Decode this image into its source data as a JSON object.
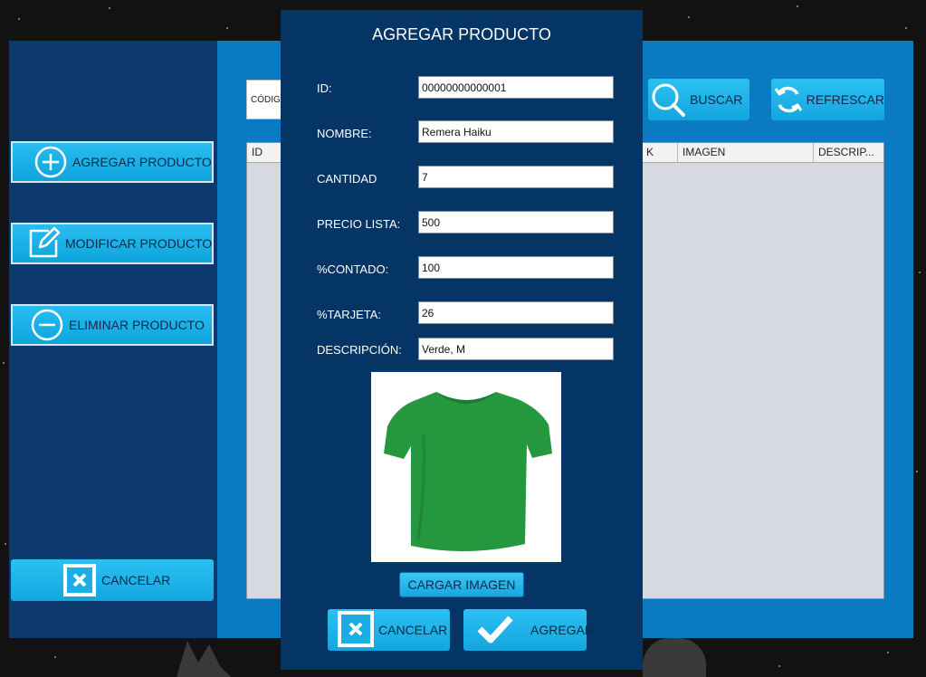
{
  "sidebar": {
    "add_label": "AGREGAR PRODUCTO",
    "modify_label": "MODIFICAR PRODUCTO",
    "delete_label": "ELIMINAR PRODUCTO",
    "cancel_label": "CANCELAR"
  },
  "toolbar": {
    "search_field_text": "CÓDIG",
    "search_label": "BUSCAR",
    "refresh_label": "REFRESCAR"
  },
  "table": {
    "columns": [
      "ID",
      "K",
      "IMAGEN",
      "DESCRIP..."
    ]
  },
  "dialog": {
    "title": "AGREGAR PRODUCTO",
    "fields": {
      "id": {
        "label": "ID:",
        "value": "00000000000001"
      },
      "name": {
        "label": "NOMBRE:",
        "value": "Remera Haiku"
      },
      "quantity": {
        "label": "CANTIDAD",
        "value": "7"
      },
      "list_price": {
        "label": "PRECIO LISTA:",
        "value": "500"
      },
      "cash_pct": {
        "label": "%CONTADO:",
        "value": "100"
      },
      "card_pct": {
        "label": "%TARJETA:",
        "value": "26"
      },
      "description": {
        "label": "DESCRIPCIÓN:",
        "value": "Verde, M"
      }
    },
    "load_image_label": "CARGAR IMAGEN",
    "cancel_label": "CANCELAR",
    "add_label": "AGREGAR"
  },
  "colors": {
    "sidebar_bg": "#0c3a6e",
    "content_bg": "#0a7bc3",
    "dialog_bg": "#053565",
    "button_accent": "#1aaee5",
    "shirt_green": "#25973f"
  },
  "icons": {
    "add": "plus-circle-icon",
    "modify": "edit-square-icon",
    "delete": "minus-circle-icon",
    "cancel": "x-square-icon",
    "search": "magnifier-icon",
    "refresh": "refresh-icon",
    "confirm": "checkmark-icon"
  }
}
